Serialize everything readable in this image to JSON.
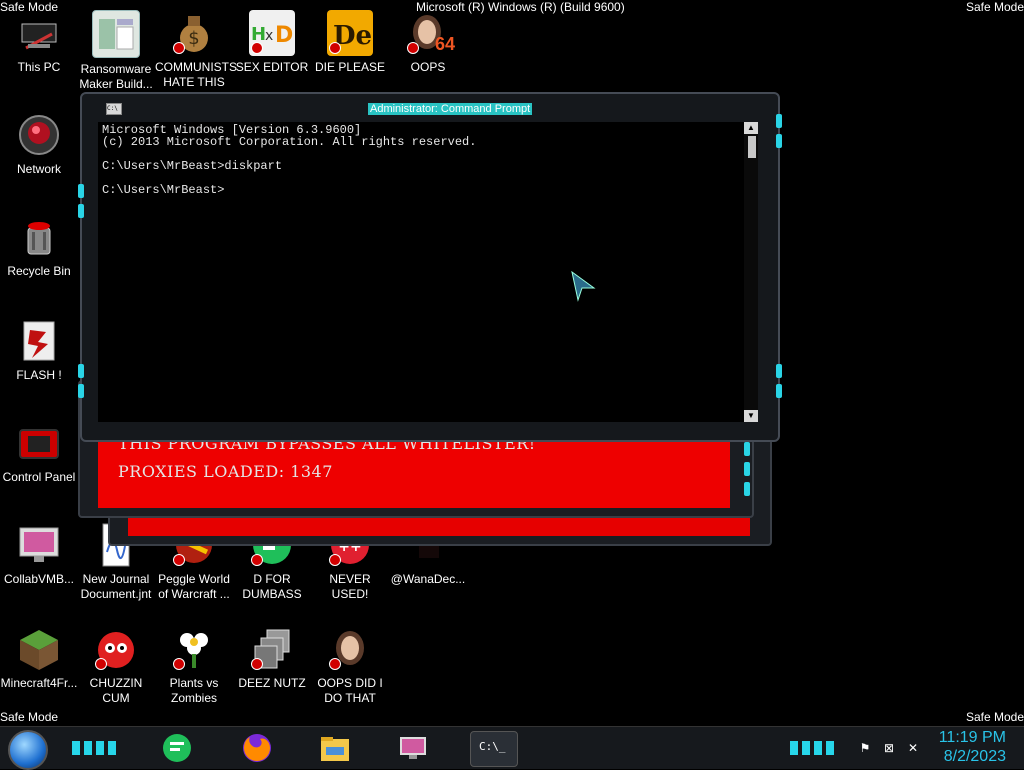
{
  "safe_mode": "Safe Mode",
  "build_text": "Microsoft (R) Windows (R) (Build 9600)",
  "desktop": {
    "icons": [
      {
        "label": "This PC"
      },
      {
        "label": "Ransomware\nMaker Build..."
      },
      {
        "label": "COMMUNISTS\nHATE THIS G..."
      },
      {
        "label": "SEX EDITOR"
      },
      {
        "label": "DIE PLEASE"
      },
      {
        "label": "OOPS"
      },
      {
        "label": "Network"
      },
      {
        "label": "Recycle Bin"
      },
      {
        "label": "FLASH !"
      },
      {
        "label": "Control Panel"
      },
      {
        "label": "CollabVMB..."
      },
      {
        "label": "New Journal\nDocument.jnt"
      },
      {
        "label": "Peggle World\nof Warcraft ..."
      },
      {
        "label": "D FOR\nDUMBASS"
      },
      {
        "label": "NEVER USED!"
      },
      {
        "label": "@WanaDec..."
      },
      {
        "label": "Minecraft4Fr..."
      },
      {
        "label": "CHUZZIN\nCUM"
      },
      {
        "label": "Plants vs\nZombies"
      },
      {
        "label": "DEEZ NUTZ"
      },
      {
        "label": "OOPS DID I\nDO THAT"
      }
    ]
  },
  "cmd": {
    "title": "Administrator: Command Prompt",
    "icon_text": "C:\\",
    "lines": "Microsoft Windows [Version 6.3.9600]\n(c) 2013 Microsoft Corporation. All rights reserved.\n\nC:\\Users\\MrBeast>diskpart\n\nC:\\Users\\MrBeast>"
  },
  "red_app": {
    "line1": "THIS PROGRAM BYPASSES ALL WHITELISTER!",
    "line2": "PROXIES LOADED: 1347"
  },
  "oops_badge": "64",
  "taskbar": {
    "time": "11:19 PM",
    "date": "8/2/2023",
    "cmd_label": "C:\\_"
  },
  "colors": {
    "accent": "#29c3e8",
    "red": "#ee0000"
  }
}
